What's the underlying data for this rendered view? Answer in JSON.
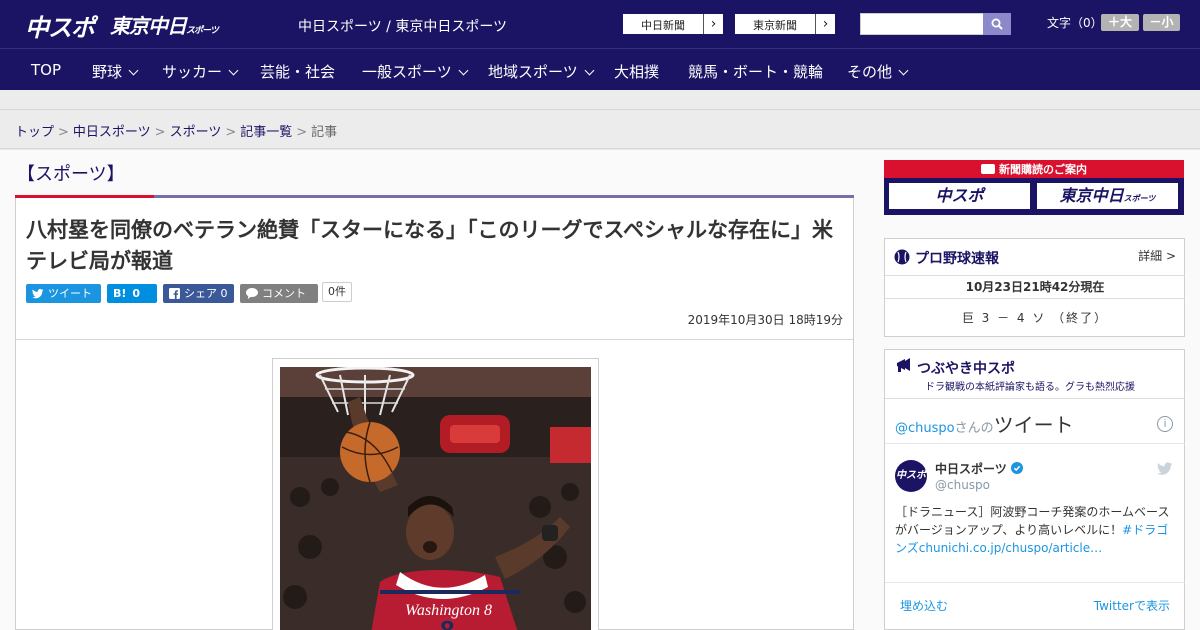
{
  "header": {
    "logo_chu": "中スポ",
    "logo_tokyo": "東京中日",
    "logo_tokyo_suffix": "スポーツ",
    "site_title": "中日スポーツ / 東京中日スポーツ",
    "paper_buttons": [
      {
        "label": "中日新聞"
      },
      {
        "label": "東京新聞"
      }
    ],
    "search_placeholder": "",
    "font_size_label": "文字（0）",
    "font_plus": "＋大",
    "font_minus": "－小"
  },
  "nav": {
    "items": [
      {
        "label": "TOP",
        "dropdown": false
      },
      {
        "label": "野球",
        "dropdown": true
      },
      {
        "label": "サッカー",
        "dropdown": true
      },
      {
        "label": "芸能・社会",
        "dropdown": false
      },
      {
        "label": "一般スポーツ",
        "dropdown": true
      },
      {
        "label": "地域スポーツ",
        "dropdown": true
      },
      {
        "label": "大相撲",
        "dropdown": false
      },
      {
        "label": "競馬・ボート・競輪",
        "dropdown": false
      },
      {
        "label": "その他",
        "dropdown": true
      }
    ]
  },
  "breadcrumb": {
    "items": [
      "トップ",
      "中日スポーツ",
      "スポーツ",
      "記事一覧"
    ],
    "current": "記事",
    "separator": ">"
  },
  "article": {
    "category": "【スポーツ】",
    "headline": "八村塁を同僚のベテラン絶賛「スターになる」「このリーグでスペシャルな存在に」米テレビ局が報道",
    "share": {
      "tweet": "ツイート",
      "hatena_count": "0",
      "facebook": "シェア 0",
      "comment": "コメント",
      "comment_count": "0件"
    },
    "date": "2019年10月30日 18時19分",
    "photo_alt": "Washington 8"
  },
  "sidebar": {
    "subscription_title": "新聞購読のご案内",
    "subscription_chu": "中スポ",
    "subscription_tokyo": "東京中日",
    "subscription_tokyo_suffix": "スポーツ",
    "baseball": {
      "title": "プロ野球速報",
      "detail": "詳細 >",
      "time": "10月23日21時42分現在",
      "score": "巨 3 － 4 ソ （終了）"
    },
    "twitter": {
      "title": "つぶやき中スポ",
      "subtitle": "ドラ観戦の本紙評論家も語る。グラも熱烈応援",
      "head_user": "@chuspo",
      "head_suffix": "さんの",
      "head_big": "ツイート",
      "avatar_text": "中スポ",
      "name": "中日スポーツ",
      "handle": "@chuspo",
      "text": "［ドラニュース］阿波野コーチ発案のホームベースがバージョンアップ、より高いレベルに！",
      "text_link": "#ドラゴンズchunichi.co.jp/chuspo/article…",
      "embed": "埋め込む",
      "view": "Twitterで表示"
    }
  },
  "colors": {
    "brand_navy": "#1b1464",
    "accent_red": "#d9112e",
    "twitter_blue": "#1b95e0",
    "facebook_blue": "#3b5998",
    "hatena_blue": "#008fde",
    "comment_gray": "#808080"
  }
}
